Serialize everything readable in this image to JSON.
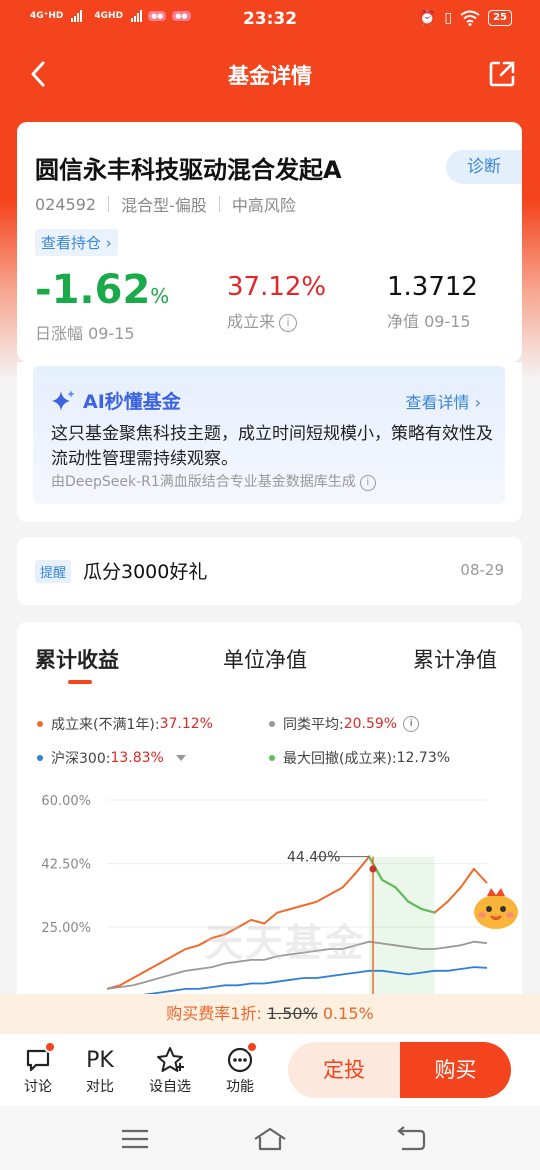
{
  "status_bar": {
    "time": "23:32",
    "net1": "4G⁺HD",
    "net2": "4GHD",
    "battery": "25"
  },
  "nav": {
    "title": "基金详情"
  },
  "fund": {
    "name": "圆信永丰科技驱动混合发起A",
    "code": "024592",
    "type": "混合型-偏股",
    "risk": "中高风险",
    "diagnose_label": "诊断",
    "holdings_link": "查看持仓 ›",
    "daily_change": "-1.62",
    "daily_change_unit": "%",
    "daily_label": "日涨幅 09-15",
    "since_inception": "37.12%",
    "since_label": "成立来",
    "nav_value": "1.3712",
    "nav_label": "净值 09-15"
  },
  "ai": {
    "title": "AI秒懂基金",
    "more": "查看详情",
    "text": "这只基金聚焦科技主题，成立时间短规模小，策略有效性及流动性管理需持续观察。",
    "footer": "由DeepSeek-R1满血版结合专业基金数据库生成"
  },
  "reminder": {
    "tag": "提醒",
    "text": "瓜分3000好礼",
    "date": "08-29"
  },
  "chart_tabs": [
    "累计收益",
    "单位净值",
    "累计净值"
  ],
  "legend": {
    "fund_label": "成立来(不满1年):",
    "fund_value": "37.12%",
    "peer_label": "同类平均:",
    "peer_value": "20.59%",
    "index_label": "沪深300:",
    "index_value": "13.83%",
    "drawdown_label": "最大回撤(成立来):",
    "drawdown_value": "12.73%"
  },
  "watermark": "天天基金",
  "chart_data": {
    "type": "line",
    "y_ticks": [
      "60.00%",
      "42.50%",
      "25.00%"
    ],
    "ylim": [
      0,
      60
    ],
    "annotation": "44.40%",
    "x": [
      0,
      1,
      2,
      3,
      4,
      5,
      6,
      7,
      8,
      9,
      10,
      11,
      12,
      13,
      14,
      15,
      16,
      17,
      18,
      19,
      20,
      21,
      22,
      23,
      24,
      25,
      26,
      27,
      28,
      29
    ],
    "series": [
      {
        "name": "成立来",
        "color": "#f06a2a",
        "values": [
          8,
          9,
          11,
          13,
          15,
          17,
          19,
          20,
          22,
          23,
          25,
          27,
          26,
          29,
          30,
          31,
          32,
          34,
          36,
          40,
          44.4,
          38,
          36,
          32,
          30,
          29,
          32,
          36,
          41,
          37.12
        ]
      },
      {
        "name": "同类平均",
        "color": "#999999",
        "values": [
          8,
          8.5,
          9,
          10,
          11,
          12,
          13,
          13.5,
          14,
          15,
          15.5,
          16,
          16,
          17,
          17.5,
          18,
          18.5,
          19,
          19,
          20,
          21,
          20.5,
          20,
          19.5,
          19,
          19,
          19.5,
          20,
          21,
          20.59
        ]
      },
      {
        "name": "沪深300",
        "color": "#2f7fd8",
        "values": [
          5,
          5.5,
          6,
          6.5,
          7,
          7.5,
          8,
          8,
          8.5,
          9,
          9,
          9.5,
          9.5,
          10,
          10.5,
          11,
          11,
          11.5,
          12,
          12.5,
          13,
          13,
          12.5,
          12,
          12.5,
          13,
          13,
          13.5,
          14,
          13.83
        ]
      }
    ]
  },
  "fee_banner": {
    "prefix": "购买费率1折: ",
    "old": "1.50%",
    "new": " 0.15%"
  },
  "bottom_bar": {
    "discuss": "讨论",
    "compare_icon": "PK",
    "compare": "对比",
    "watchlist": "设自选",
    "features": "功能",
    "sip": "定投",
    "buy": "购买"
  }
}
